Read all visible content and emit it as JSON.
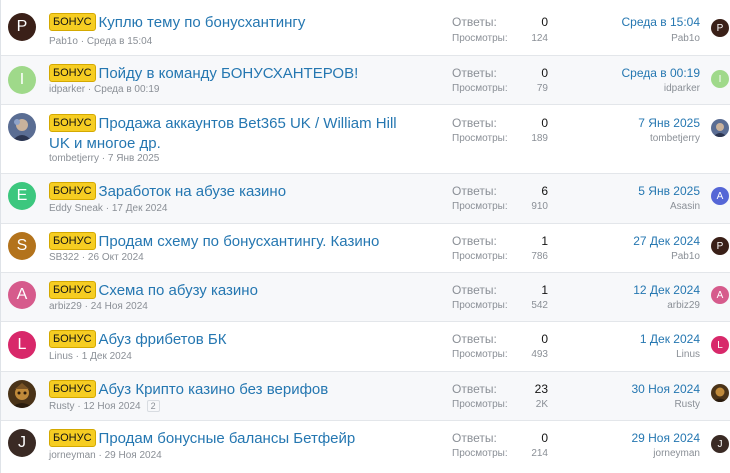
{
  "labels": {
    "replies": "Ответы:",
    "views": "Просмотры:"
  },
  "badge_text": "БОНУС",
  "threads": [
    {
      "title": "Куплю тему по бонусхантингу",
      "author": "Pab1o",
      "date": "Среда в 15:04",
      "replies": "0",
      "views": "124",
      "last_date": "Среда в 15:04",
      "last_user": "Pab1o",
      "avatar_letter": "P",
      "avatar_color": "#3a2018",
      "last_avatar_letter": "P",
      "last_avatar_color": "#3a2018"
    },
    {
      "title": "Пойду в команду БОНУСХАНТЕРОВ!",
      "author": "idparker",
      "date": "Среда в 00:19",
      "replies": "0",
      "views": "79",
      "last_date": "Среда в 00:19",
      "last_user": "idparker",
      "avatar_letter": "I",
      "avatar_color": "#9fd98a",
      "last_avatar_letter": "I",
      "last_avatar_color": "#9fd98a"
    },
    {
      "title": "Продажа аккаунтов Bet365 UK / William Hill UK и многое др.",
      "author": "tombetjerry",
      "date": "7 Янв 2025",
      "replies": "0",
      "views": "189",
      "last_date": "7 Янв 2025",
      "last_user": "tombetjerry",
      "avatar_letter": "",
      "avatar_color": "#6c7ea8",
      "last_avatar_letter": "",
      "last_avatar_color": "#6c7ea8"
    },
    {
      "title": "Заработок на абузе казино",
      "author": "Eddy Sneak",
      "date": "17 Дек 2024",
      "replies": "6",
      "views": "910",
      "last_date": "5 Янв 2025",
      "last_user": "Asasin",
      "avatar_letter": "E",
      "avatar_color": "#3cc77e",
      "last_avatar_letter": "A",
      "last_avatar_color": "#5566d6"
    },
    {
      "title": "Продам схему по бонусхантингу. Казино",
      "author": "SB322",
      "date": "26 Окт 2024",
      "replies": "1",
      "views": "786",
      "last_date": "27 Дек 2024",
      "last_user": "Pab1o",
      "avatar_letter": "S",
      "avatar_color": "#b3731c",
      "last_avatar_letter": "P",
      "last_avatar_color": "#3a2018"
    },
    {
      "title": "Схема по абузу казино",
      "author": "arbiz29",
      "date": "24 Ноя 2024",
      "replies": "1",
      "views": "542",
      "last_date": "12 Дек 2024",
      "last_user": "arbiz29",
      "avatar_letter": "A",
      "avatar_color": "#d65b8c",
      "last_avatar_letter": "A",
      "last_avatar_color": "#d65b8c"
    },
    {
      "title": "Абуз фрибетов БК",
      "author": "Linus",
      "date": "1 Дек 2024",
      "replies": "0",
      "views": "493",
      "last_date": "1 Дек 2024",
      "last_user": "Linus",
      "avatar_letter": "L",
      "avatar_color": "#d8286a",
      "last_avatar_letter": "L",
      "last_avatar_color": "#d8286a"
    },
    {
      "title": "Абуз Крипто казино без верифов",
      "author": "Rusty",
      "date": "12 Ноя 2024",
      "pages": "2",
      "replies": "23",
      "views": "2K",
      "last_date": "30 Ноя 2024",
      "last_user": "Rusty",
      "avatar_letter": "",
      "avatar_color": "#6a4a22",
      "last_avatar_letter": "",
      "last_avatar_color": "#6a4a22"
    },
    {
      "title": "Продам бонусные балансы Бетфейр",
      "author": "jorneyman",
      "date": "29 Ноя 2024",
      "replies": "0",
      "views": "214",
      "last_date": "29 Ноя 2024",
      "last_user": "jorneyman",
      "avatar_letter": "J",
      "avatar_color": "#3a2a24",
      "last_avatar_letter": "J",
      "last_avatar_color": "#3a2a24"
    }
  ]
}
